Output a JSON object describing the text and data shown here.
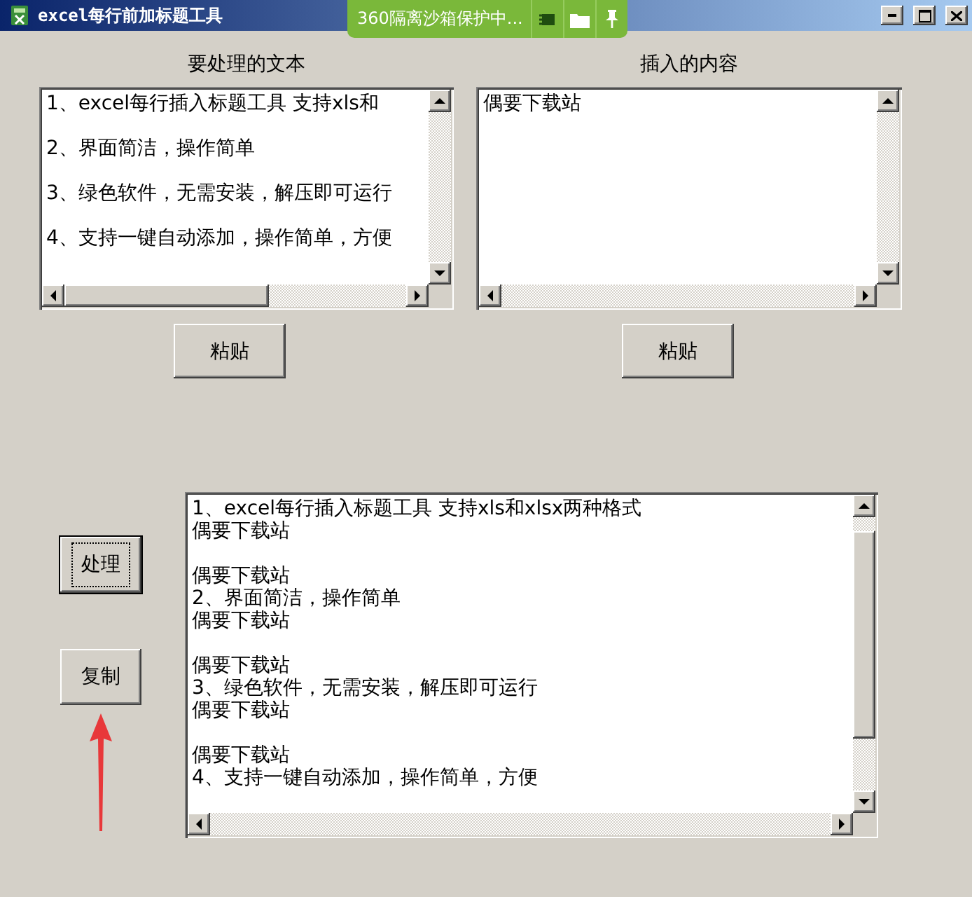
{
  "window": {
    "title": "excel每行前加标题工具"
  },
  "sandbox_banner": {
    "text": "360隔离沙箱保护中..."
  },
  "source_panel": {
    "label": "要处理的文本",
    "lines": [
      "1、excel每行插入标题工具 支持xls和",
      "2、界面简洁，操作简单",
      "3、绿色软件，无需安装，解压即可运行",
      "4、支持一键自动添加，操作简单，方便"
    ],
    "paste_button": "粘贴"
  },
  "insert_panel": {
    "label": "插入的内容",
    "lines": [
      "偶要下载站"
    ],
    "paste_button": "粘贴"
  },
  "actions": [
    {
      "label": "处理",
      "focused": true
    },
    {
      "label": "复制",
      "focused": false
    }
  ],
  "output": {
    "blocks": [
      [
        "1、excel每行插入标题工具 支持xls和xlsx两种格式",
        "偶要下载站"
      ],
      [
        "偶要下载站",
        "2、界面简洁，操作简单",
        "偶要下载站"
      ],
      [
        "偶要下载站",
        "3、绿色软件，无需安装，解压即可运行",
        "偶要下载站"
      ],
      [
        "偶要下载站",
        "4、支持一键自动添加，操作简单，方便"
      ]
    ]
  }
}
